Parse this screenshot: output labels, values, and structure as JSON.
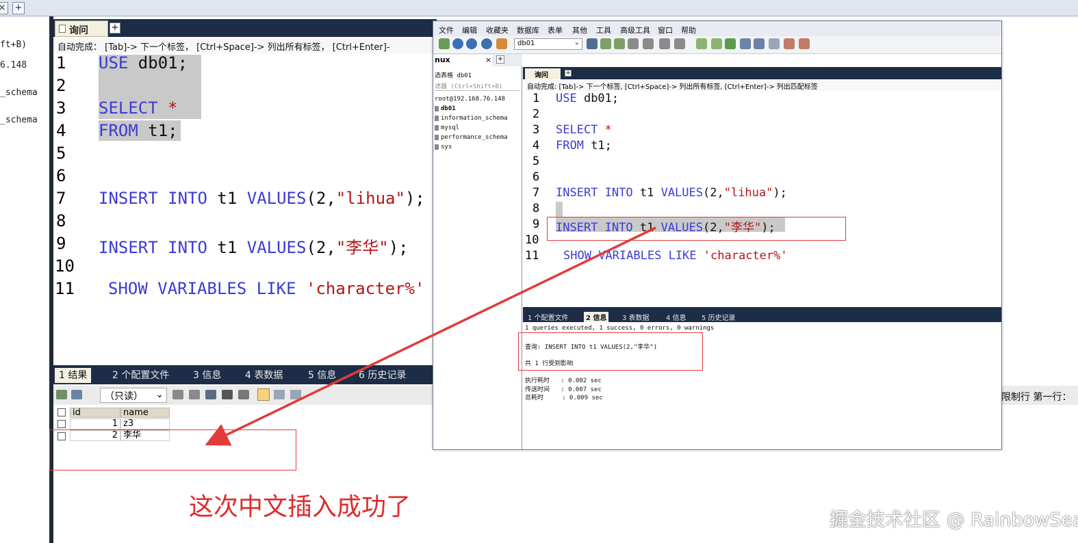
{
  "top_strip": {
    "close_glyph": "×",
    "plus_glyph": "+"
  },
  "sidebar": {
    "items": [
      "ft+B)",
      "6.148",
      "_schema",
      "_schema"
    ]
  },
  "bg_editor": {
    "tab_label": "询问",
    "tab_plus": "+",
    "hint": "自动完成： [Tab]-> 下一个标签， [Ctrl+Space]-> 列出所有标签， [Ctrl+Enter]-",
    "line_numbers": [
      "1",
      "2",
      "3",
      "4",
      "5",
      "6",
      "7",
      "8",
      "9",
      "10",
      "11"
    ],
    "lines": {
      "l1_kw": "USE",
      "l1_rest": " db01;",
      "l3_kw": "SELECT",
      "l3_rest": " *",
      "l4_kw": "FROM",
      "l4_rest": " t1;",
      "l7_kw1": "INSERT",
      "l7_kw2": "INTO",
      "l7_t": " t1 ",
      "l7_kw3": "VALUES",
      "l7_a": "(2,",
      "l7_s": "\"lihua\"",
      "l7_b": ");",
      "l9_kw1": "INSERT",
      "l9_kw2": "INTO",
      "l9_t": " t1 ",
      "l9_kw3": "VALUES",
      "l9_a": "(2,",
      "l9_s": "\"李华\"",
      "l9_b": ");",
      "l11_kw1": "SHOW",
      "l11_kw2": "VARIABLES",
      "l11_kw3": "LIKE",
      "l11_s": "'character%'"
    }
  },
  "bg_results": {
    "tabs": [
      "1 结果",
      "2 个配置文件",
      "3 信息",
      "4 表数据",
      "5 信息",
      "6 历史记录"
    ],
    "readonly": "（只读）",
    "columns": [
      "id",
      "name"
    ],
    "rows": [
      {
        "id": "1",
        "name": "z3"
      },
      {
        "id": "2",
        "name": "李华"
      }
    ],
    "right_text": "限制行 第一行："
  },
  "inset": {
    "menu": [
      "文件",
      "编辑",
      "收藏夹",
      "数据库",
      "表单",
      "其他",
      "工具",
      "高级工具",
      "窗口",
      "帮助"
    ],
    "db_select": "db01",
    "left_tab": "nux",
    "left_tab_close": "×",
    "left_tab_plus": "+",
    "left_items": [
      "选表格 db01",
      "滤器 (Ctrl+Shift+B)",
      "root@192.168.76.148",
      "db01",
      "information_schema",
      "mysql",
      "performance_schema",
      "sys"
    ],
    "query_tab": "询问",
    "query_plus": "+",
    "hint": "自动完成: [Tab]-> 下一个标签, [Ctrl+Space]-> 列出所有标签, [Ctrl+Enter]-> 列出匹配标签",
    "line_numbers": [
      "1",
      "2",
      "3",
      "4",
      "5",
      "6",
      "7",
      "8",
      "9",
      "10",
      "11"
    ],
    "result_tabs": [
      "1 个配置文件",
      "2 信息",
      "3 表数据",
      "4 信息",
      "5 历史记录"
    ],
    "messages": {
      "summary": "1 queries executed, 1 success, 0 errors, 0 warnings",
      "query": "查询: INSERT INTO t1 VALUES(2,\"李华\")",
      "affected": "共 1 行受到影响",
      "exec": "执行耗时   : 0.002 sec",
      "transfer": "传送时间   : 0.007 sec",
      "total": "总耗时     : 0.009 sec"
    }
  },
  "caption": "这次中文插入成功了",
  "watermark": "掘金技术社区 @ RainbowSea",
  "colors": {
    "keyword": "#3b3bd6",
    "string": "#b21818",
    "annotation": "#e23b3b",
    "dark_bar": "#1d2d47"
  }
}
